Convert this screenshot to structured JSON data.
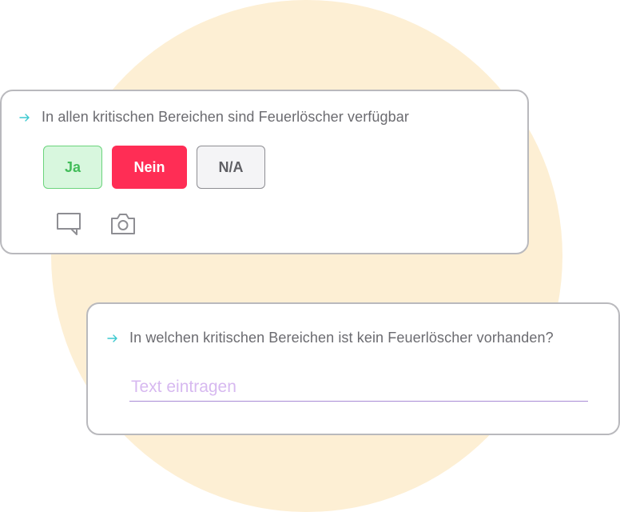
{
  "card_1": {
    "question": "In allen kritischen Bereichen sind Feuerlöscher verfügbar",
    "answers": {
      "yes_label": "Ja",
      "no_label": "Nein",
      "na_label": "N/A",
      "selected": "Nein"
    },
    "actions": {
      "comment_icon": "comment-icon",
      "camera_icon": "camera-icon"
    }
  },
  "card_2": {
    "question": "In welchen kritischen Bereichen ist kein Feuerlöscher vorhanden?",
    "input": {
      "value": "",
      "placeholder": "Text eintragen"
    }
  },
  "colors": {
    "accent_arrow": "#3cc9cf",
    "yes_green": "#43bd5a",
    "no_red": "#ff2d55",
    "placeholder_purple": "#d7b9f0",
    "background_circle": "#fdefd4"
  }
}
